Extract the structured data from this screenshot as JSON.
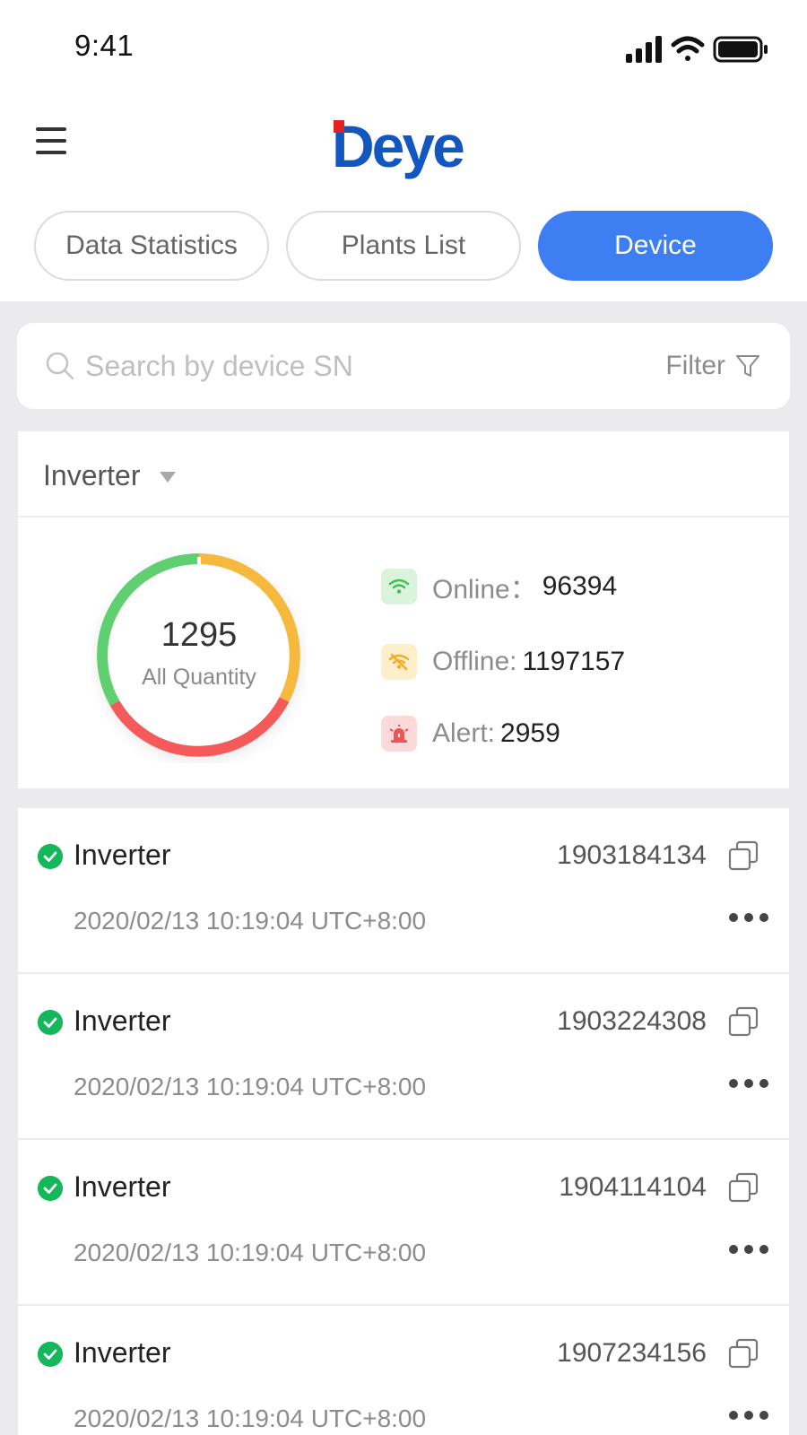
{
  "status_bar": {
    "time": "9:41"
  },
  "logo": {
    "text": "Deye"
  },
  "tabs": [
    {
      "label": "Data Statistics",
      "active": false
    },
    {
      "label": "Plants List",
      "active": false
    },
    {
      "label": "Device",
      "active": true
    }
  ],
  "search": {
    "placeholder": "Search by device SN",
    "value": "",
    "filter_label": "Filter"
  },
  "summary": {
    "device_type": "Inverter",
    "total": "1295",
    "total_label": "All Quantity",
    "ring_colors": {
      "online": "#5fcf6f",
      "offline": "#f5b93e",
      "alert": "#f55a5a"
    },
    "stats": {
      "online_label": "Online：",
      "online_value": "96394",
      "offline_label": "Offline:",
      "offline_value": "1197157",
      "alert_label": "Alert:",
      "alert_value": "2959"
    }
  },
  "devices": [
    {
      "name": "Inverter",
      "sn": "1903184134",
      "time": "2020/02/13 10:19:04 UTC+8:00",
      "status": "online"
    },
    {
      "name": "Inverter",
      "sn": "1903224308",
      "time": "2020/02/13 10:19:04 UTC+8:00",
      "status": "online"
    },
    {
      "name": "Inverter",
      "sn": "1904114104",
      "time": "2020/02/13 10:19:04 UTC+8:00",
      "status": "online"
    },
    {
      "name": "Inverter",
      "sn": "1907234156",
      "time": "2020/02/13 10:19:04 UTC+8:00",
      "status": "online"
    }
  ],
  "colors": {
    "accent": "#3d7ff2",
    "brand": "#1256c0",
    "online_check": "#14b75a"
  }
}
